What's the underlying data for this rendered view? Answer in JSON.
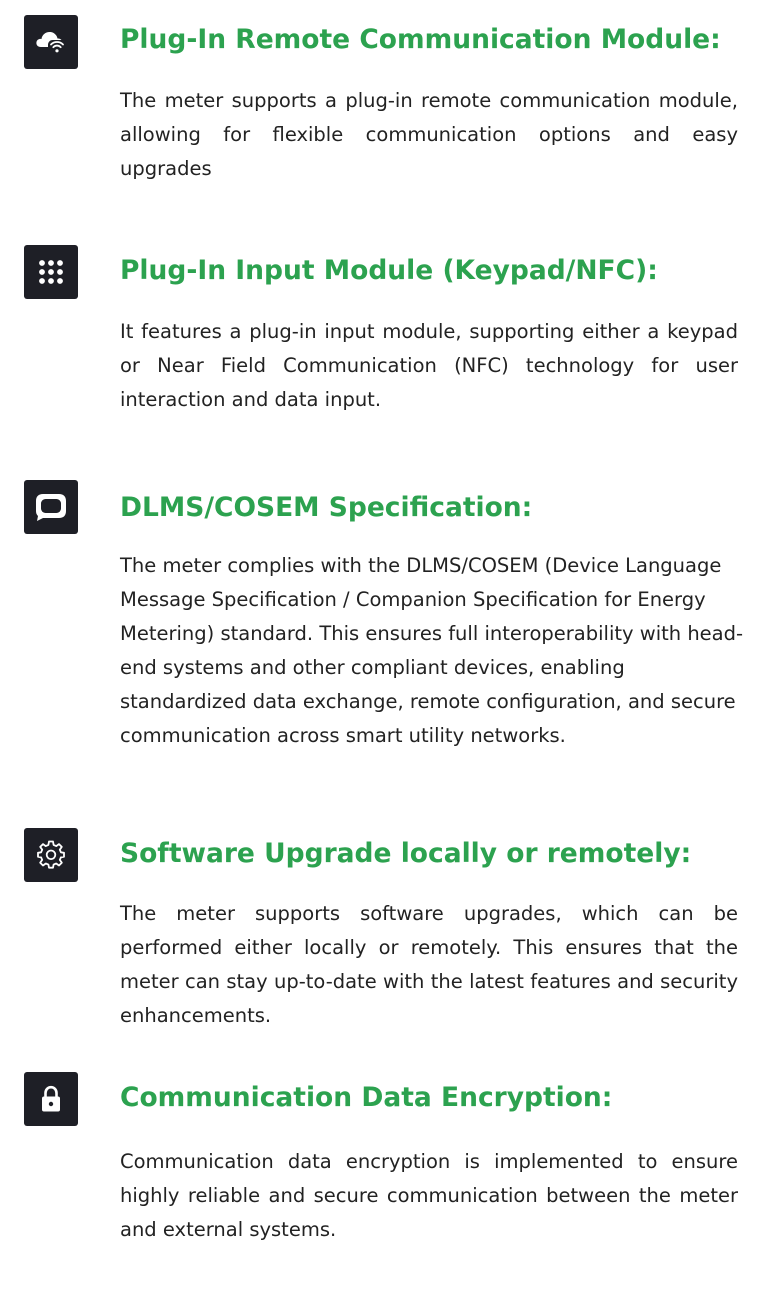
{
  "colors": {
    "title_green": "#2ca24f",
    "icon_bg": "#1e1f26",
    "body_text": "#222222"
  },
  "features": [
    {
      "icon": "cloud-wifi-icon",
      "title": "Plug-In Remote Communication Module:",
      "description": "The meter supports a plug-in remote communication module, allowing for flexible communication options and easy upgrades"
    },
    {
      "icon": "keypad-grid-icon",
      "title": "Plug-In Input Module (Keypad/NFC):",
      "description": "It features a plug-in input module, supporting either a keypad or Near Field Communication (NFC) technology for user interaction and data input."
    },
    {
      "icon": "chat-bubble-icon",
      "title": "DLMS/COSEM Specification:",
      "description": "The meter complies with the DLMS/COSEM (Device Language Message Specification / Companion Specification for Energy Metering) standard. This ensures full interoperability with head-end systems and other compliant devices, enabling standardized data exchange, remote configuration, and secure communication across smart utility networks."
    },
    {
      "icon": "gear-icon",
      "title": "Software Upgrade locally or remotely:",
      "description": "The meter supports software upgrades, which can be performed either locally or remotely. This ensures that the meter can stay up-to-date with the latest features and security enhancements."
    },
    {
      "icon": "lock-icon",
      "title": "Communication Data Encryption:",
      "description": "Communication data encryption is implemented to ensure highly reliable and secure communication between the meter and external systems."
    }
  ]
}
